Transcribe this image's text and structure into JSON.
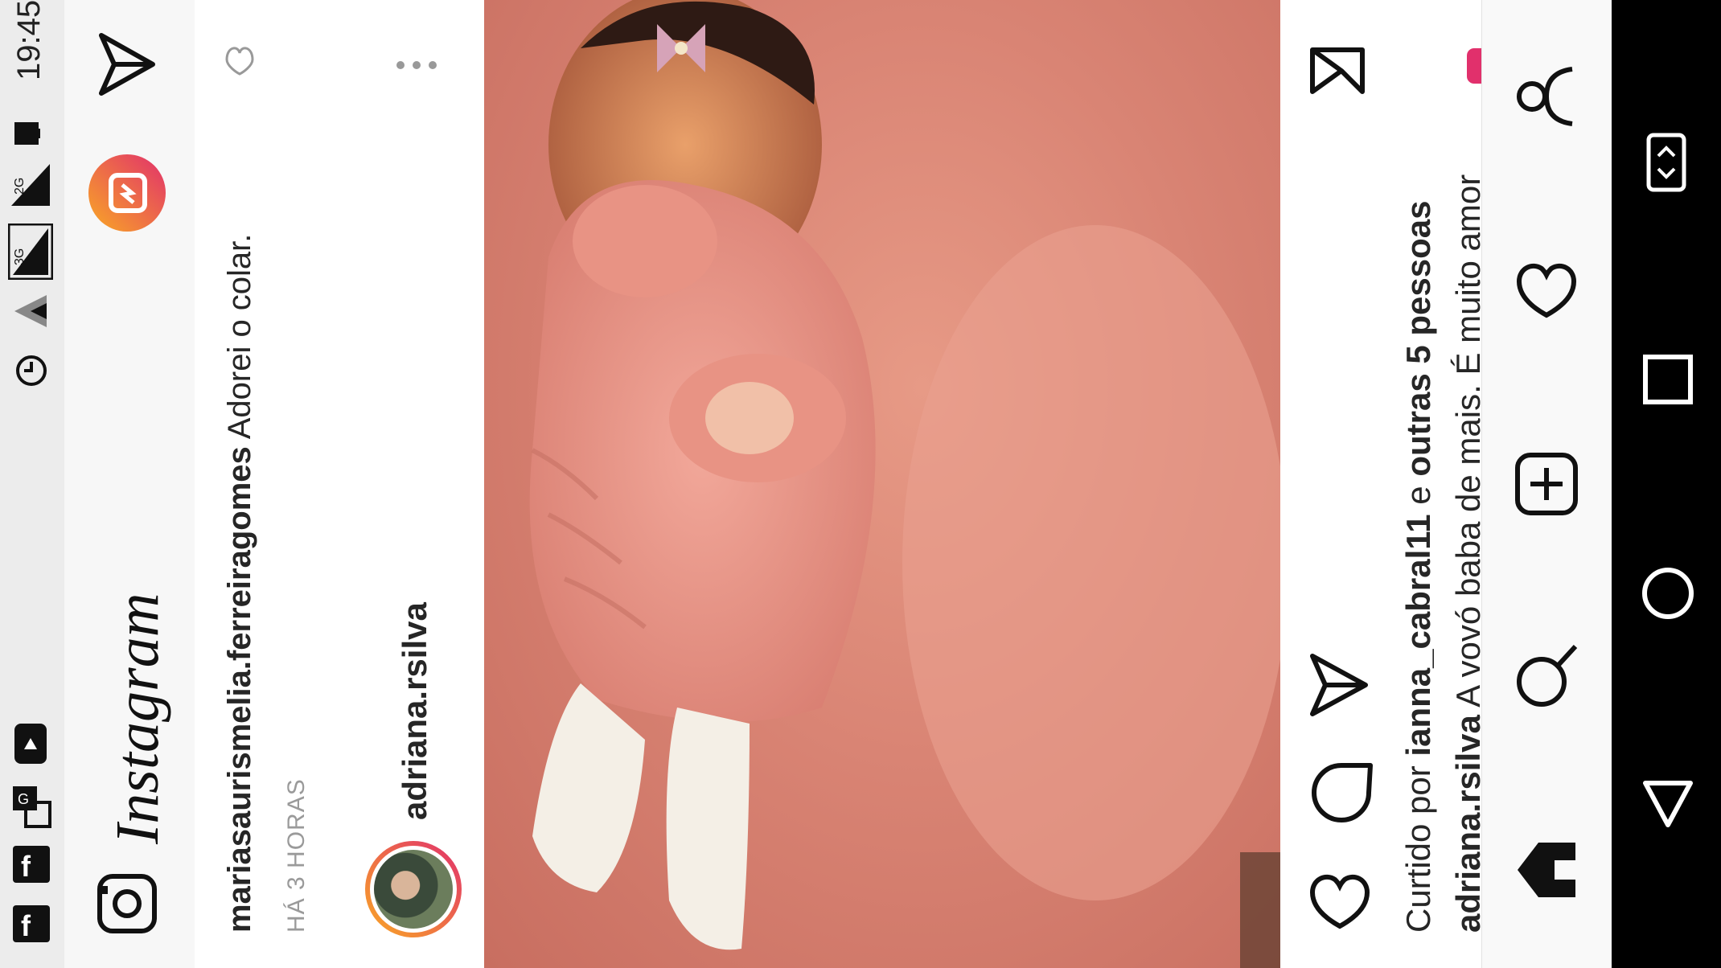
{
  "status_bar": {
    "time": "19:45",
    "signal_3g": "3G",
    "signal_2g": "2G",
    "icons": [
      "facebook-icon",
      "facebook-icon",
      "translate-icon",
      "youtube-icon",
      "alarm-icon",
      "wifi-icon",
      "signal-3g-icon",
      "signal-2g-icon",
      "battery-icon"
    ]
  },
  "app_bar": {
    "logo_text": "Instagram",
    "icons": [
      "camera-icon",
      "igtv-icon",
      "direct-send-icon"
    ]
  },
  "post": {
    "comment_username": "mariasaurismelia.ferreiragomes",
    "comment_text": "Adorei o colar.",
    "timestamp": "HÁ 3 HORAS",
    "author": "adriana.rsilva",
    "photo_description_icon": "baby-photo"
  },
  "likes": {
    "prefix": "Curtido por",
    "user": "ianna_cabral11",
    "conjunction": "e",
    "others": "outras 5 pessoas"
  },
  "caption": {
    "username": "adriana.rsilva",
    "text": "A vovó baba de mais. É muito amor"
  },
  "bottom_nav": {
    "icons": [
      "home-icon",
      "search-icon",
      "add-post-icon",
      "activity-heart-icon",
      "profile-icon"
    ]
  },
  "colors": {
    "instagram_gradient_start": "#f9a825",
    "instagram_gradient_end": "#e1306c",
    "text_primary": "#262626",
    "text_secondary": "#8e8e8e",
    "photo_pink": "#d98474"
  }
}
